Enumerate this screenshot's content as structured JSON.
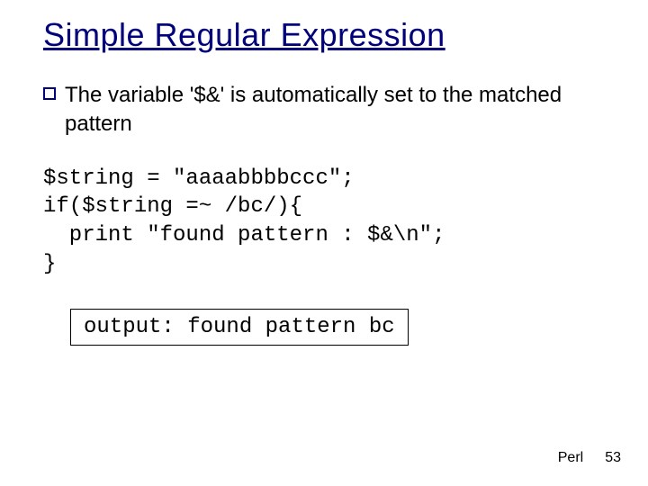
{
  "title": "Simple Regular Expression",
  "bullet": {
    "text": "The variable '$&' is automatically set to the matched pattern"
  },
  "code": "$string = \"aaaabbbbccc\";\nif($string =~ /bc/){\n  print \"found pattern : $&\\n\";\n}",
  "output_box": "output: found pattern bc",
  "footer": {
    "label": "Perl",
    "page": "53"
  }
}
